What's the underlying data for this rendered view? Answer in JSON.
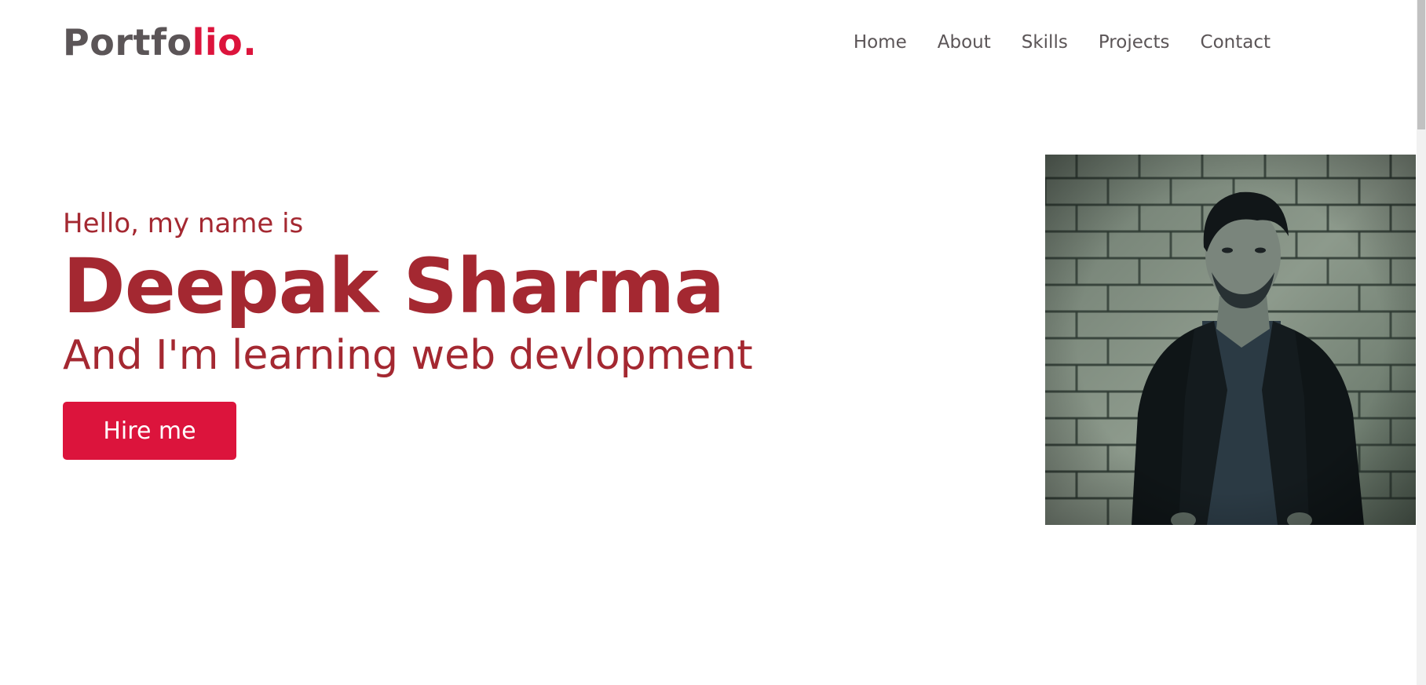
{
  "logo": {
    "prefix": "Portfo",
    "suffix": "lio."
  },
  "nav": {
    "items": [
      {
        "label": "Home"
      },
      {
        "label": "About"
      },
      {
        "label": "Skills"
      },
      {
        "label": "Projects"
      },
      {
        "label": "Contact"
      }
    ]
  },
  "hero": {
    "greeting": "Hello, my name is",
    "name": "Deepak Sharma",
    "tagline": "And I'm learning web devlopment",
    "cta_label": "Hire me"
  },
  "colors": {
    "accent": "#dc143c",
    "heading": "#a42831",
    "nav_text": "#5b5557"
  },
  "icons": {
    "profile": "profile-photo"
  }
}
